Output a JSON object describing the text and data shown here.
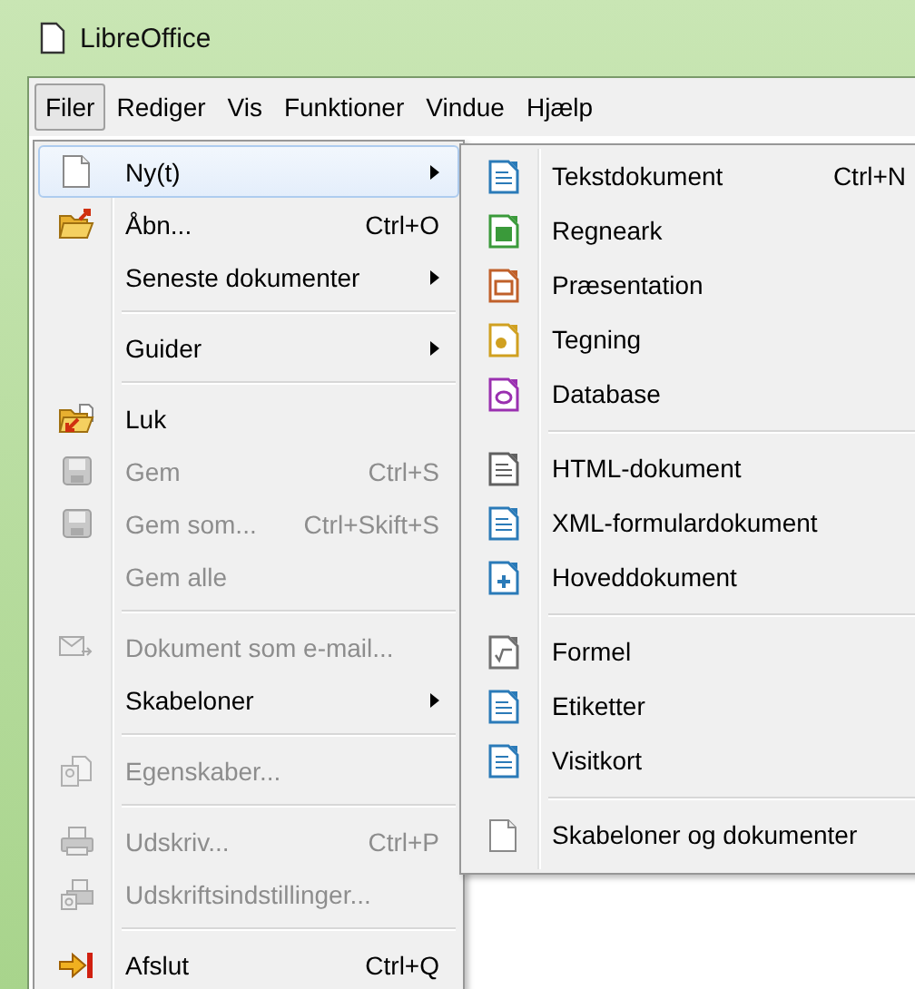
{
  "window": {
    "title": "LibreOffice"
  },
  "menubar": [
    {
      "label": "Filer",
      "selected": true
    },
    {
      "label": "Rediger",
      "selected": false
    },
    {
      "label": "Vis",
      "selected": false
    },
    {
      "label": "Funktioner",
      "selected": false
    },
    {
      "label": "Vindue",
      "selected": false
    },
    {
      "label": "Hjælp",
      "selected": false
    }
  ],
  "file_menu": [
    {
      "kind": "item",
      "label": "Ny(t)",
      "submenu": true,
      "disabled": false,
      "selected": true
    },
    {
      "kind": "item",
      "label": "Åbn...",
      "shortcut": "Ctrl+O",
      "disabled": false,
      "selected": false
    },
    {
      "kind": "item",
      "label": "Seneste dokumenter",
      "submenu": true,
      "disabled": false,
      "selected": false
    },
    {
      "kind": "separator"
    },
    {
      "kind": "item",
      "label": "Guider",
      "submenu": true,
      "disabled": false,
      "selected": false
    },
    {
      "kind": "separator"
    },
    {
      "kind": "item",
      "label": "Luk",
      "disabled": false,
      "selected": false
    },
    {
      "kind": "item",
      "label": "Gem",
      "shortcut": "Ctrl+S",
      "disabled": true,
      "selected": false
    },
    {
      "kind": "item",
      "label": "Gem som...",
      "shortcut": "Ctrl+Skift+S",
      "disabled": true,
      "selected": false
    },
    {
      "kind": "item",
      "label": "Gem alle",
      "disabled": true,
      "selected": false
    },
    {
      "kind": "separator"
    },
    {
      "kind": "item",
      "label": "Dokument som e-mail...",
      "disabled": true,
      "selected": false
    },
    {
      "kind": "item",
      "label": "Skabeloner",
      "submenu": true,
      "disabled": false,
      "selected": false
    },
    {
      "kind": "separator"
    },
    {
      "kind": "item",
      "label": "Egenskaber...",
      "disabled": true,
      "selected": false
    },
    {
      "kind": "separator"
    },
    {
      "kind": "item",
      "label": "Udskriv...",
      "shortcut": "Ctrl+P",
      "disabled": true,
      "selected": false
    },
    {
      "kind": "item",
      "label": "Udskriftsindstillinger...",
      "disabled": true,
      "selected": false
    },
    {
      "kind": "separator"
    },
    {
      "kind": "item",
      "label": "Afslut",
      "shortcut": "Ctrl+Q",
      "disabled": false,
      "selected": false
    }
  ],
  "new_submenu": [
    {
      "kind": "item",
      "label": "Tekstdokument",
      "shortcut": "Ctrl+N",
      "disabled": false,
      "selected": false
    },
    {
      "kind": "item",
      "label": "Regneark",
      "disabled": false,
      "selected": false
    },
    {
      "kind": "item",
      "label": "Præsentation",
      "disabled": false,
      "selected": false
    },
    {
      "kind": "item",
      "label": "Tegning",
      "disabled": false,
      "selected": false
    },
    {
      "kind": "item",
      "label": "Database",
      "disabled": false,
      "selected": false
    },
    {
      "kind": "separator"
    },
    {
      "kind": "item",
      "label": "HTML-dokument",
      "disabled": false,
      "selected": false
    },
    {
      "kind": "item",
      "label": "XML-formulardokument",
      "disabled": false,
      "selected": false
    },
    {
      "kind": "item",
      "label": "Hoveddokument",
      "disabled": false,
      "selected": false
    },
    {
      "kind": "separator"
    },
    {
      "kind": "item",
      "label": "Formel",
      "disabled": false,
      "selected": false
    },
    {
      "kind": "item",
      "label": "Etiketter",
      "disabled": false,
      "selected": false
    },
    {
      "kind": "item",
      "label": "Visitkort",
      "disabled": false,
      "selected": false
    },
    {
      "kind": "separator"
    },
    {
      "kind": "item",
      "label": "Skabeloner og dokumenter",
      "disabled": false,
      "selected": false
    }
  ]
}
